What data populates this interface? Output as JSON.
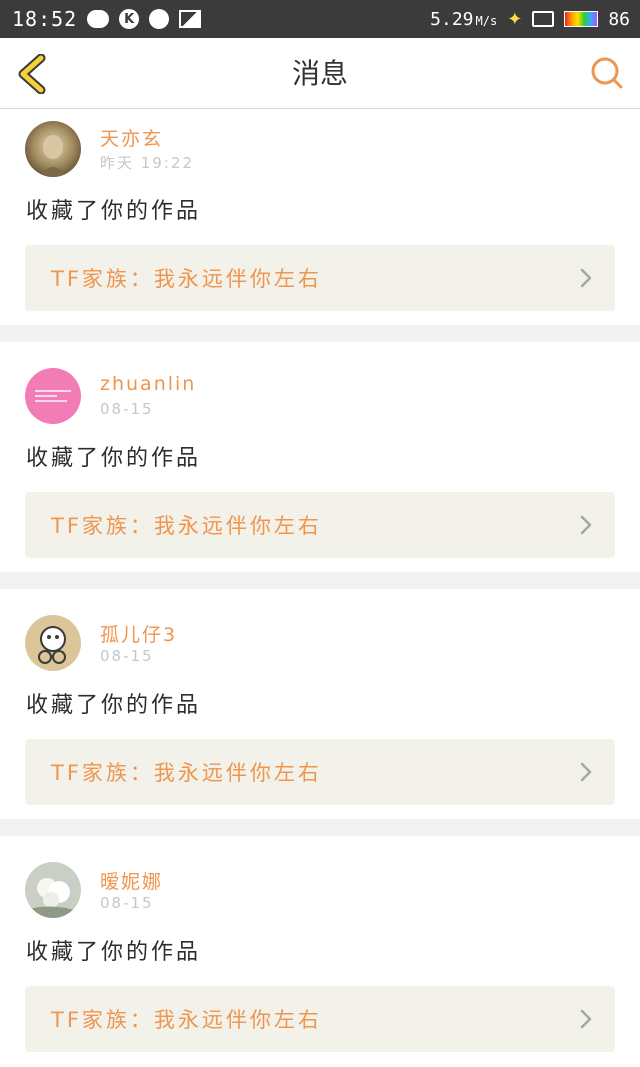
{
  "status_bar": {
    "time": "18:52",
    "net_speed": "5.29",
    "net_speed_unit": "M/s",
    "battery": "86"
  },
  "nav": {
    "title": "消息"
  },
  "messages": [
    {
      "username": "天亦玄",
      "time": "昨天 19:22",
      "action": "收藏了你的作品",
      "work_title": "TF家族：我永远伴你左右"
    },
    {
      "username": "zhuanlin",
      "time": "08-15",
      "action": "收藏了你的作品",
      "work_title": "TF家族：我永远伴你左右"
    },
    {
      "username": "孤儿仔3",
      "time": "08-15",
      "action": "收藏了你的作品",
      "work_title": "TF家族：我永远伴你左右"
    },
    {
      "username": "暧妮娜",
      "time": "08-15",
      "action": "收藏了你的作品",
      "work_title": "TF家族：我永远伴你左右"
    }
  ],
  "colors": {
    "accent": "#f0954e",
    "card_bg": "#f3f2ea",
    "back_icon": "#f5b82e"
  }
}
